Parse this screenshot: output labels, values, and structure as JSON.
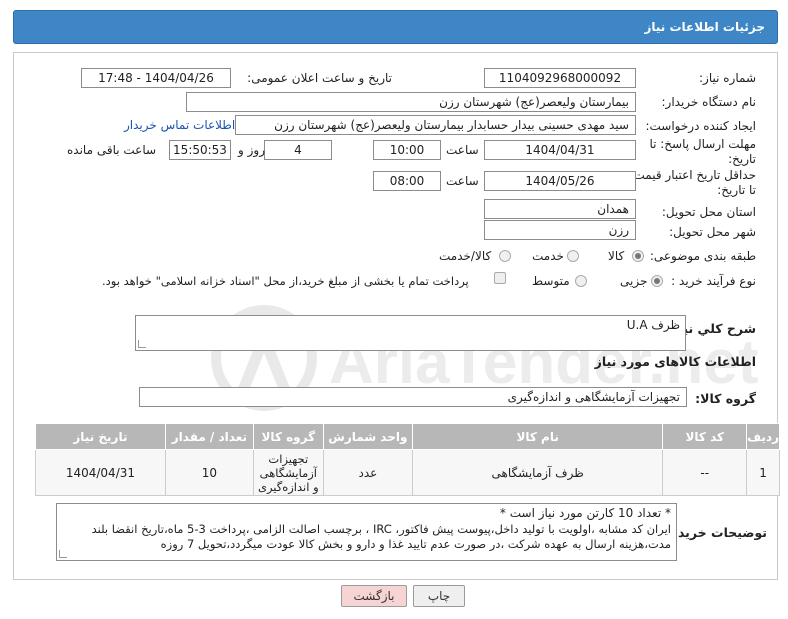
{
  "window": {
    "title": "جزئیات اطلاعات نیاز"
  },
  "form": {
    "need_number_label": "شماره نیاز:",
    "need_number": "1104092968000092",
    "announce_label": "تاریخ و ساعت اعلان عمومی:",
    "announce_value": "1404/04/26 - 17:48",
    "buyer_org_label": "نام دستگاه خریدار:",
    "buyer_org": "بیمارستان ولیعصر(عج) شهرستان رزن",
    "creator_label": "ایجاد کننده درخواست:",
    "creator": "سید مهدی حسینی بیدار حسابدار بیمارستان ولیعصر(عج) شهرستان رزن",
    "contact_link": "اطلاعات تماس خریدار",
    "deadline_label_1": "مهلت ارسال پاسخ: تا",
    "deadline_label_2": "تاریخ:",
    "deadline_date": "1404/04/31",
    "time_label": "ساعت",
    "deadline_time": "10:00",
    "days_value": "4",
    "days_label": "روز و",
    "remaining_time": "15:50:53",
    "remaining_label": "ساعت باقی مانده",
    "validity_label_1": "حداقل تاریخ اعتبار قیمت:",
    "validity_label_2": "تا تاریخ:",
    "validity_date": "1404/05/26",
    "validity_time_label": "ساعت",
    "validity_time": "08:00",
    "province_label": "استان محل تحویل:",
    "province": "همدان",
    "city_label": "شهر محل تحویل:",
    "city": "رزن",
    "category_label": "طبقه بندی موضوعی:",
    "category_options": [
      "کالا",
      "خدمت",
      "کالا/خدمت"
    ],
    "process_label": "نوع فرآیند خرید :",
    "process_options": [
      "جزیی",
      "متوسط"
    ],
    "payment_note": "پرداخت تمام یا بخشی از مبلغ خرید،از محل \"اسناد خزانه اسلامی\" خواهد بود.",
    "summary_label": "شرح كلي نياز:",
    "summary_value": "ظرف U.A",
    "goods_info_title": "اطلاعات کالاهای مورد نیاز",
    "goods_group_label": "گروه کالا:",
    "goods_group": "تجهیزات آزمایشگاهی و اندازه‌گیری"
  },
  "table": {
    "headers": [
      "ردیف",
      "کد کالا",
      "نام کالا",
      "واحد شمارش",
      "گروه کالا",
      "تعداد / مقدار",
      "تاریخ نیاز"
    ],
    "rows": [
      [
        "1",
        "--",
        "ظرف آزمایشگاهی",
        "عدد",
        "تجهیزات آزمایشگاهی و اندازه‌گیری",
        "10",
        "1404/04/31"
      ]
    ]
  },
  "notes": {
    "label": "توضیحات خریدار:",
    "line1": "* تعداد 10 کارتن مورد نیاز است *",
    "line2": "ایران کد مشابه ،اولویت با تولید داخل،پیوست پیش فاکتور، IRC ، برچسب اصالت الزامی ،پرداخت 3-5 ماه،تاریخ انقضا بلند",
    "line3": "مدت،هزینه ارسال به عهده شرکت ،در صورت عدم تایید غذا و دارو و بخش کالا عودت میگردد،تحویل 7 روزه"
  },
  "buttons": {
    "print": "چاپ",
    "return": "بازگشت"
  },
  "watermark": {
    "text": "AriaTender.net"
  },
  "colors": {
    "title_bg": "#3f86c7",
    "table_header_bg": "#b7b7b7",
    "return_bg": "#f7d4d4",
    "link": "#1a56b0"
  }
}
